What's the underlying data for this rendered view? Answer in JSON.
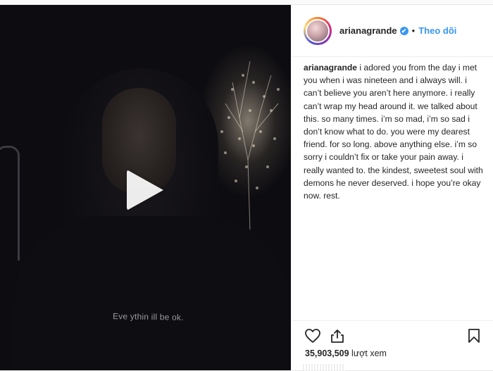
{
  "post": {
    "username": "arianagrande",
    "verified_badge": "✔",
    "separator": "•",
    "follow_label": "Theo dõi",
    "caption_username": "arianagrande",
    "caption_text": "i adored you from the day i met you when i was nineteen and i always will. i can’t believe you aren’t here anymore. i really can’t wrap my head around it. we talked about this. so many times. i’m so mad, i’m so sad i don’t know what to do. you were my dearest friend. for so long. above anything else. i’m so sorry i couldn’t fix or take your pain away. i really wanted to. the kindest, sweetest soul with demons he never deserved. i hope you’re okay now. rest.",
    "views_count": "35,903,509",
    "views_label": "lượt xem"
  },
  "video": {
    "shirt_text": "Eve ythin  ill be ok.",
    "play_icon": "play-icon"
  },
  "actions": {
    "like_icon": "heart-icon",
    "share_icon": "share-icon",
    "save_icon": "bookmark-icon"
  },
  "colors": {
    "accent": "#3897f0",
    "text": "#262626"
  }
}
